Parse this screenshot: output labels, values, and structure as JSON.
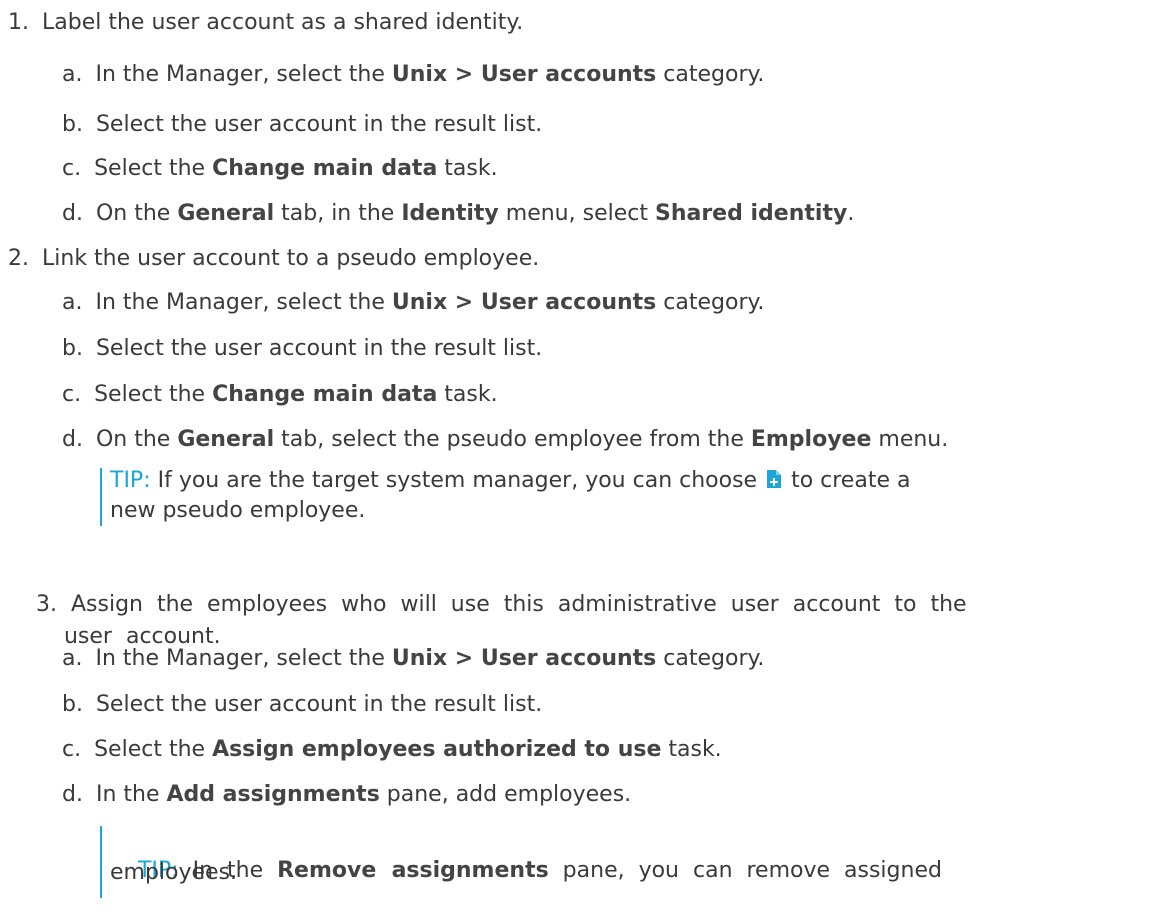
{
  "steps": [
    {
      "number": "1.",
      "text": "Label the user account as a shared identity.",
      "substeps": [
        {
          "letter": "a.",
          "p1": "In the Manager, select the ",
          "b1": "Unix > User accounts",
          "p2": " category."
        },
        {
          "letter": "b.",
          "p1": "Select the user account in the result list."
        },
        {
          "letter": "c.",
          "p1": "Select the ",
          "b1": "Change main data",
          "p2": " task."
        },
        {
          "letter": "d.",
          "p1": "On the ",
          "b1": "General",
          "p2": " tab, in the ",
          "b2": "Identity",
          "p3": " menu, select ",
          "b3": "Shared identity",
          "p4": "."
        }
      ]
    },
    {
      "number": "2.",
      "text": "Link the user account to a pseudo employee.",
      "substeps": [
        {
          "letter": "a.",
          "p1": "In the Manager, select the ",
          "b1": "Unix > User accounts",
          "p2": " category."
        },
        {
          "letter": "b.",
          "p1": "Select the user account in the result list."
        },
        {
          "letter": "c.",
          "p1": "Select the ",
          "b1": "Change main data",
          "p2": " task."
        },
        {
          "letter": "d.",
          "p1": "On the ",
          "b1": "General",
          "p2": " tab, select the pseudo employee from the ",
          "b2": "Employee",
          "p3": " menu."
        }
      ],
      "tip": {
        "label": "TIP:",
        "line1_before": " If you are the target system manager, you can choose ",
        "line1_after": " to create a",
        "line2": "new pseudo employee."
      }
    },
    {
      "number": "3.",
      "line1": "Assign  the  employees  who  will  use  this  administrative  user  account  to  the",
      "line2": "user  account.",
      "substeps": [
        {
          "letter": "a.",
          "p1": "In the Manager, select the ",
          "b1": "Unix > User accounts",
          "p2": " category."
        },
        {
          "letter": "b.",
          "p1": "Select the user account in the result list."
        },
        {
          "letter": "c.",
          "p1": "Select the ",
          "b1": "Assign employees authorized to use",
          "p2": " task."
        },
        {
          "letter": "d.",
          "p1": "In the ",
          "b1": "Add assignments",
          "p2": " pane, add employees."
        }
      ],
      "tip": {
        "label": "TIP:",
        "line1_before": "  In  the  ",
        "bold": "Remove  assignments",
        "line1_after": "  pane,  you  can  remove  assigned",
        "line2": "employees."
      }
    }
  ],
  "icons": {
    "new_object": "add-new-icon",
    "icon_color": "#1aa6d8"
  }
}
